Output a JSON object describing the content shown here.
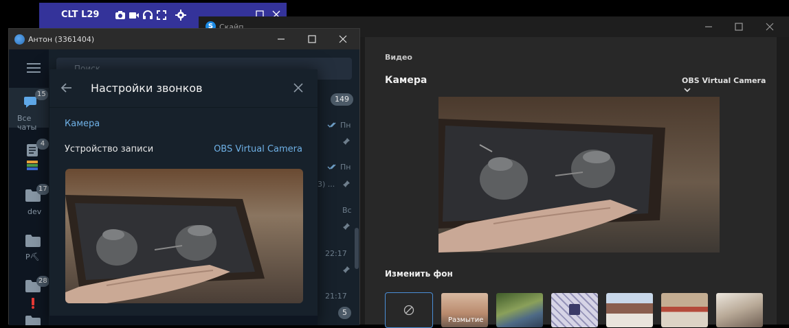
{
  "phone_bar": {
    "device_name": "CLT L29",
    "icons": [
      "camera-icon",
      "video-icon",
      "headphones-icon",
      "fullscreen-icon",
      "gear-icon"
    ]
  },
  "skype": {
    "title": "Скайп",
    "logo_letter": "S",
    "video_label": "Видео",
    "camera_label": "Камера",
    "camera_device": "OBS Virtual Camera",
    "background_label": "Изменить фон",
    "bg_tiles": [
      {
        "caption": "Размытие"
      },
      {
        "caption": ""
      },
      {
        "caption": ""
      },
      {
        "caption": ""
      },
      {
        "caption": ""
      },
      {
        "caption": ""
      }
    ]
  },
  "telegram": {
    "title": "Антон (3361404)",
    "search_placeholder": "Поиск",
    "sidebar": [
      {
        "label": "Все чаты",
        "badge": "15"
      },
      {
        "label": "",
        "badge": "4"
      },
      {
        "label": "dev",
        "badge": "17"
      },
      {
        "label": "Р⛏",
        "badge": ""
      },
      {
        "label": "",
        "badge": "28"
      },
      {
        "label": "",
        "badge": ""
      }
    ],
    "list": [
      {
        "time": "",
        "badge": "149",
        "extra": ""
      },
      {
        "time": "Пн",
        "badge": "",
        "extra": ""
      },
      {
        "time": "Пн",
        "badge": "",
        "extra": "3) ..."
      },
      {
        "time": "Вс",
        "badge": "",
        "extra": ""
      },
      {
        "time": "22:17",
        "badge": "",
        "extra": ""
      },
      {
        "time": "21:17",
        "badge": "5",
        "extra": ""
      }
    ],
    "dialog": {
      "title": "Настройки звонков",
      "section": "Камера",
      "device_label": "Устройство записи",
      "device_value": "OBS Virtual Camera"
    }
  }
}
